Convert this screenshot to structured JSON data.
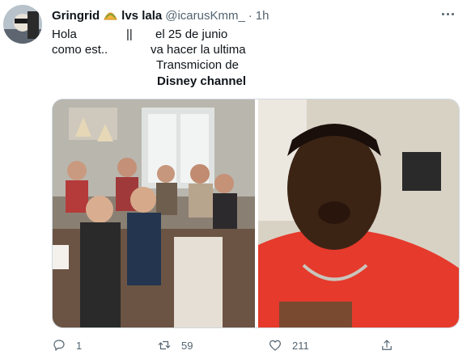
{
  "tweet": {
    "author": {
      "display_name": "Gringrid",
      "name_suffix": "lvs lala",
      "handle": "@icarusKmm_",
      "separator": "·",
      "time": "1h"
    },
    "body": {
      "col1_line1": "Hola",
      "col1_line2": "como est..",
      "col2_line1": "||",
      "col3_line1": "el 25 de junio",
      "col3_line2": "va hacer la ultima",
      "col3_line3": "Transmicion de",
      "col3_line4": "Disney channel"
    },
    "media": {
      "left_image": "group-dinner-photo",
      "right_image": "crying-boy-photo"
    },
    "actions": {
      "reply_count": "1",
      "retweet_count": "59",
      "like_count": "211"
    }
  },
  "colors": {
    "text_primary": "#0f1419",
    "text_secondary": "#536471",
    "border": "#cfd9de"
  },
  "icons": [
    "avatar",
    "emoji-taco-icon",
    "more-icon",
    "reply-icon",
    "retweet-icon",
    "like-icon",
    "share-icon"
  ]
}
